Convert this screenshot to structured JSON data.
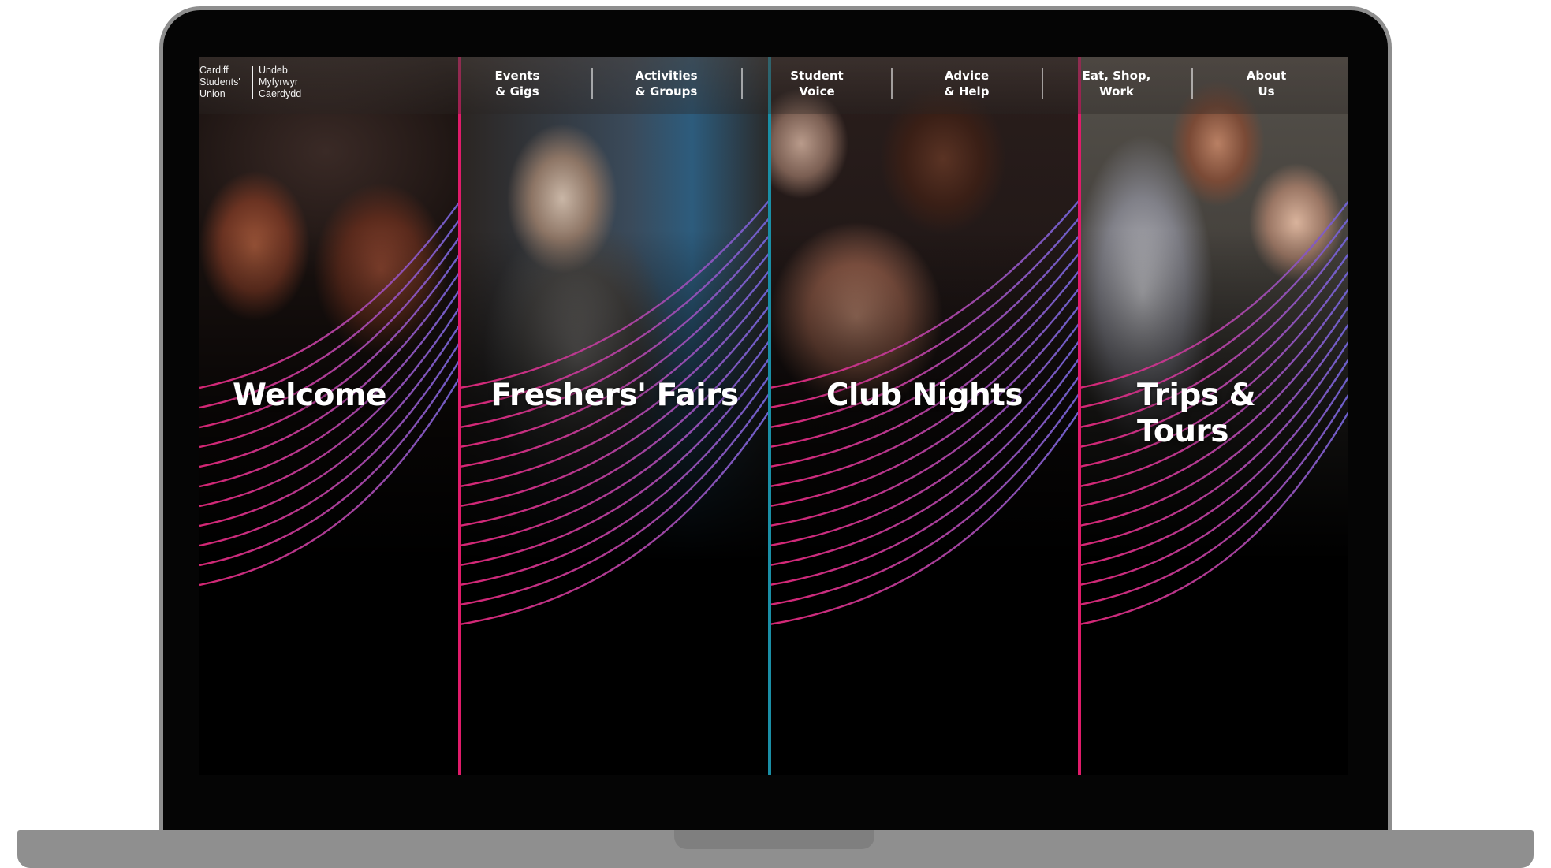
{
  "logo": {
    "english": "Cardiff\nStudents'\nUnion",
    "welsh": "Undeb\nMyfyrwyr\nCaerdydd"
  },
  "nav": [
    {
      "label": "Events\n& Gigs"
    },
    {
      "label": "Activities\n& Groups"
    },
    {
      "label": "Student\nVoice"
    },
    {
      "label": "Advice\n& Help"
    },
    {
      "label": "Eat, Shop,\nWork"
    },
    {
      "label": "About\nUs"
    }
  ],
  "panels": [
    {
      "title": "Welcome"
    },
    {
      "title": "Freshers' Fairs"
    },
    {
      "title": "Club Nights"
    },
    {
      "title": "Trips & Tours"
    }
  ],
  "colors": {
    "accent_pink": "#e01b6a",
    "accent_teal": "#1a8ea5",
    "wave_start": "#e0287a",
    "wave_end": "#6a66d8"
  }
}
